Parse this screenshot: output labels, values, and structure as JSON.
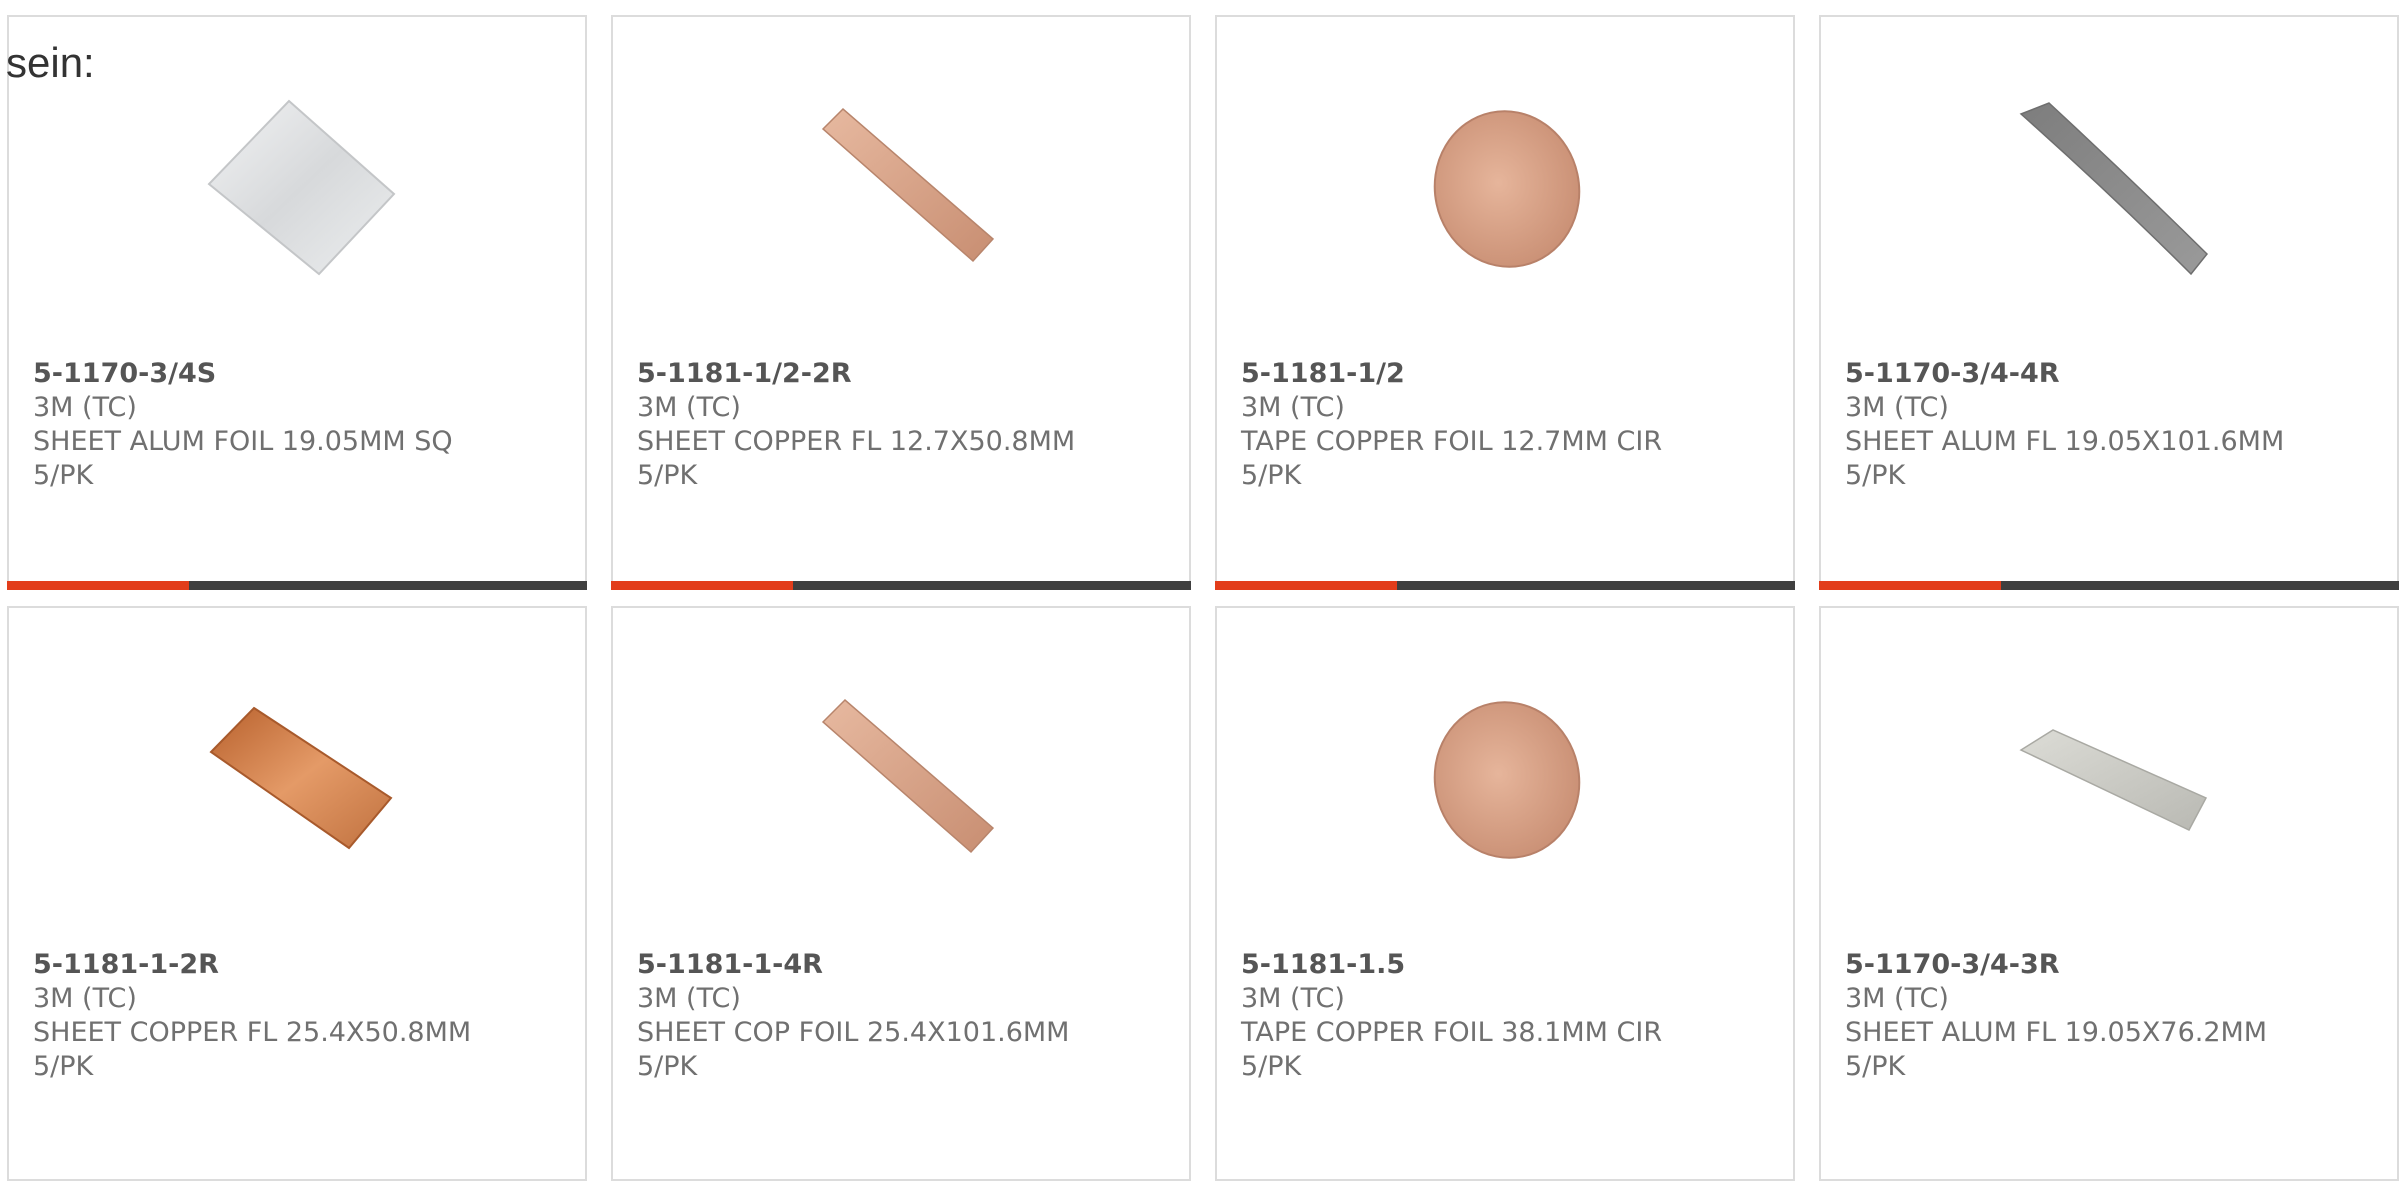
{
  "intro_text": "sein:",
  "colors": {
    "accent_bar": "#e23d1b",
    "dark_bar": "#3f3f3f",
    "aluminum": "#c9c9c9",
    "copper": "#d8a58a",
    "copper_bright": "#c9733f"
  },
  "products": [
    {
      "part_number": "5-1170-3/4S",
      "brand": "3M (TC)",
      "description": "SHEET ALUM FOIL 19.05MM SQ",
      "packaging": "5/PK",
      "image_icon": "aluminum-square-sheet-icon"
    },
    {
      "part_number": "5-1181-1/2-2R",
      "brand": "3M (TC)",
      "description": "SHEET COPPER FL 12.7X50.8MM",
      "packaging": "5/PK",
      "image_icon": "copper-strip-icon"
    },
    {
      "part_number": "5-1181-1/2",
      "brand": "3M (TC)",
      "description": "TAPE COPPER FOIL 12.7MM CIR",
      "packaging": "5/PK",
      "image_icon": "copper-disc-icon"
    },
    {
      "part_number": "5-1170-3/4-4R",
      "brand": "3M (TC)",
      "description": "SHEET ALUM FL 19.05X101.6MM",
      "packaging": "5/PK",
      "image_icon": "aluminum-strip-icon"
    },
    {
      "part_number": "5-1181-1-2R",
      "brand": "3M (TC)",
      "description": "SHEET COPPER FL 25.4X50.8MM",
      "packaging": "5/PK",
      "image_icon": "copper-rect-sheet-icon"
    },
    {
      "part_number": "5-1181-1-4R",
      "brand": "3M (TC)",
      "description": "SHEET COP FOIL 25.4X101.6MM",
      "packaging": "5/PK",
      "image_icon": "copper-strip-icon"
    },
    {
      "part_number": "5-1181-1.5",
      "brand": "3M (TC)",
      "description": "TAPE COPPER FOIL 38.1MM CIR",
      "packaging": "5/PK",
      "image_icon": "copper-disc-icon"
    },
    {
      "part_number": "5-1170-3/4-3R",
      "brand": "3M (TC)",
      "description": "SHEET ALUM FL 19.05X76.2MM",
      "packaging": "5/PK",
      "image_icon": "aluminum-strip-icon"
    }
  ]
}
